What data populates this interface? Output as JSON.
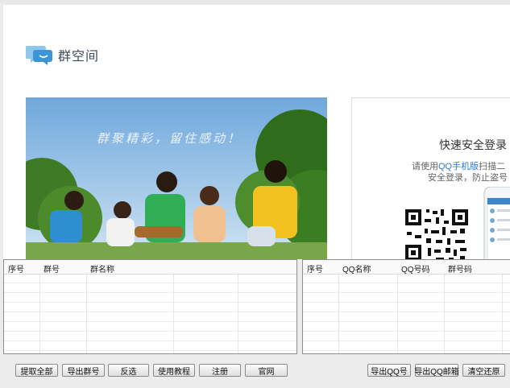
{
  "web": {
    "logo_text": "群空间",
    "slogan": "群聚精彩，留住感动！",
    "login": {
      "title": "快速安全登录",
      "desc_prefix": "请使用",
      "desc_highlight": "QQ手机版",
      "desc_suffix": "扫描二",
      "desc_line2": "安全登录，防止盗号"
    }
  },
  "left_table": {
    "columns": [
      "序号",
      "群号",
      "群名称"
    ]
  },
  "right_table": {
    "columns": [
      "序号",
      "QQ名称",
      "QQ号码",
      "群号码"
    ]
  },
  "left_buttons": [
    "提取全部",
    "导出群号",
    "反选",
    "使用教程",
    "注册",
    "官网"
  ],
  "right_buttons": [
    "导出QQ号",
    "导出QQ邮箱",
    "清空还原"
  ],
  "colors": {
    "accent": "#2a7bd3",
    "logo_blue": "#4aa3df"
  }
}
